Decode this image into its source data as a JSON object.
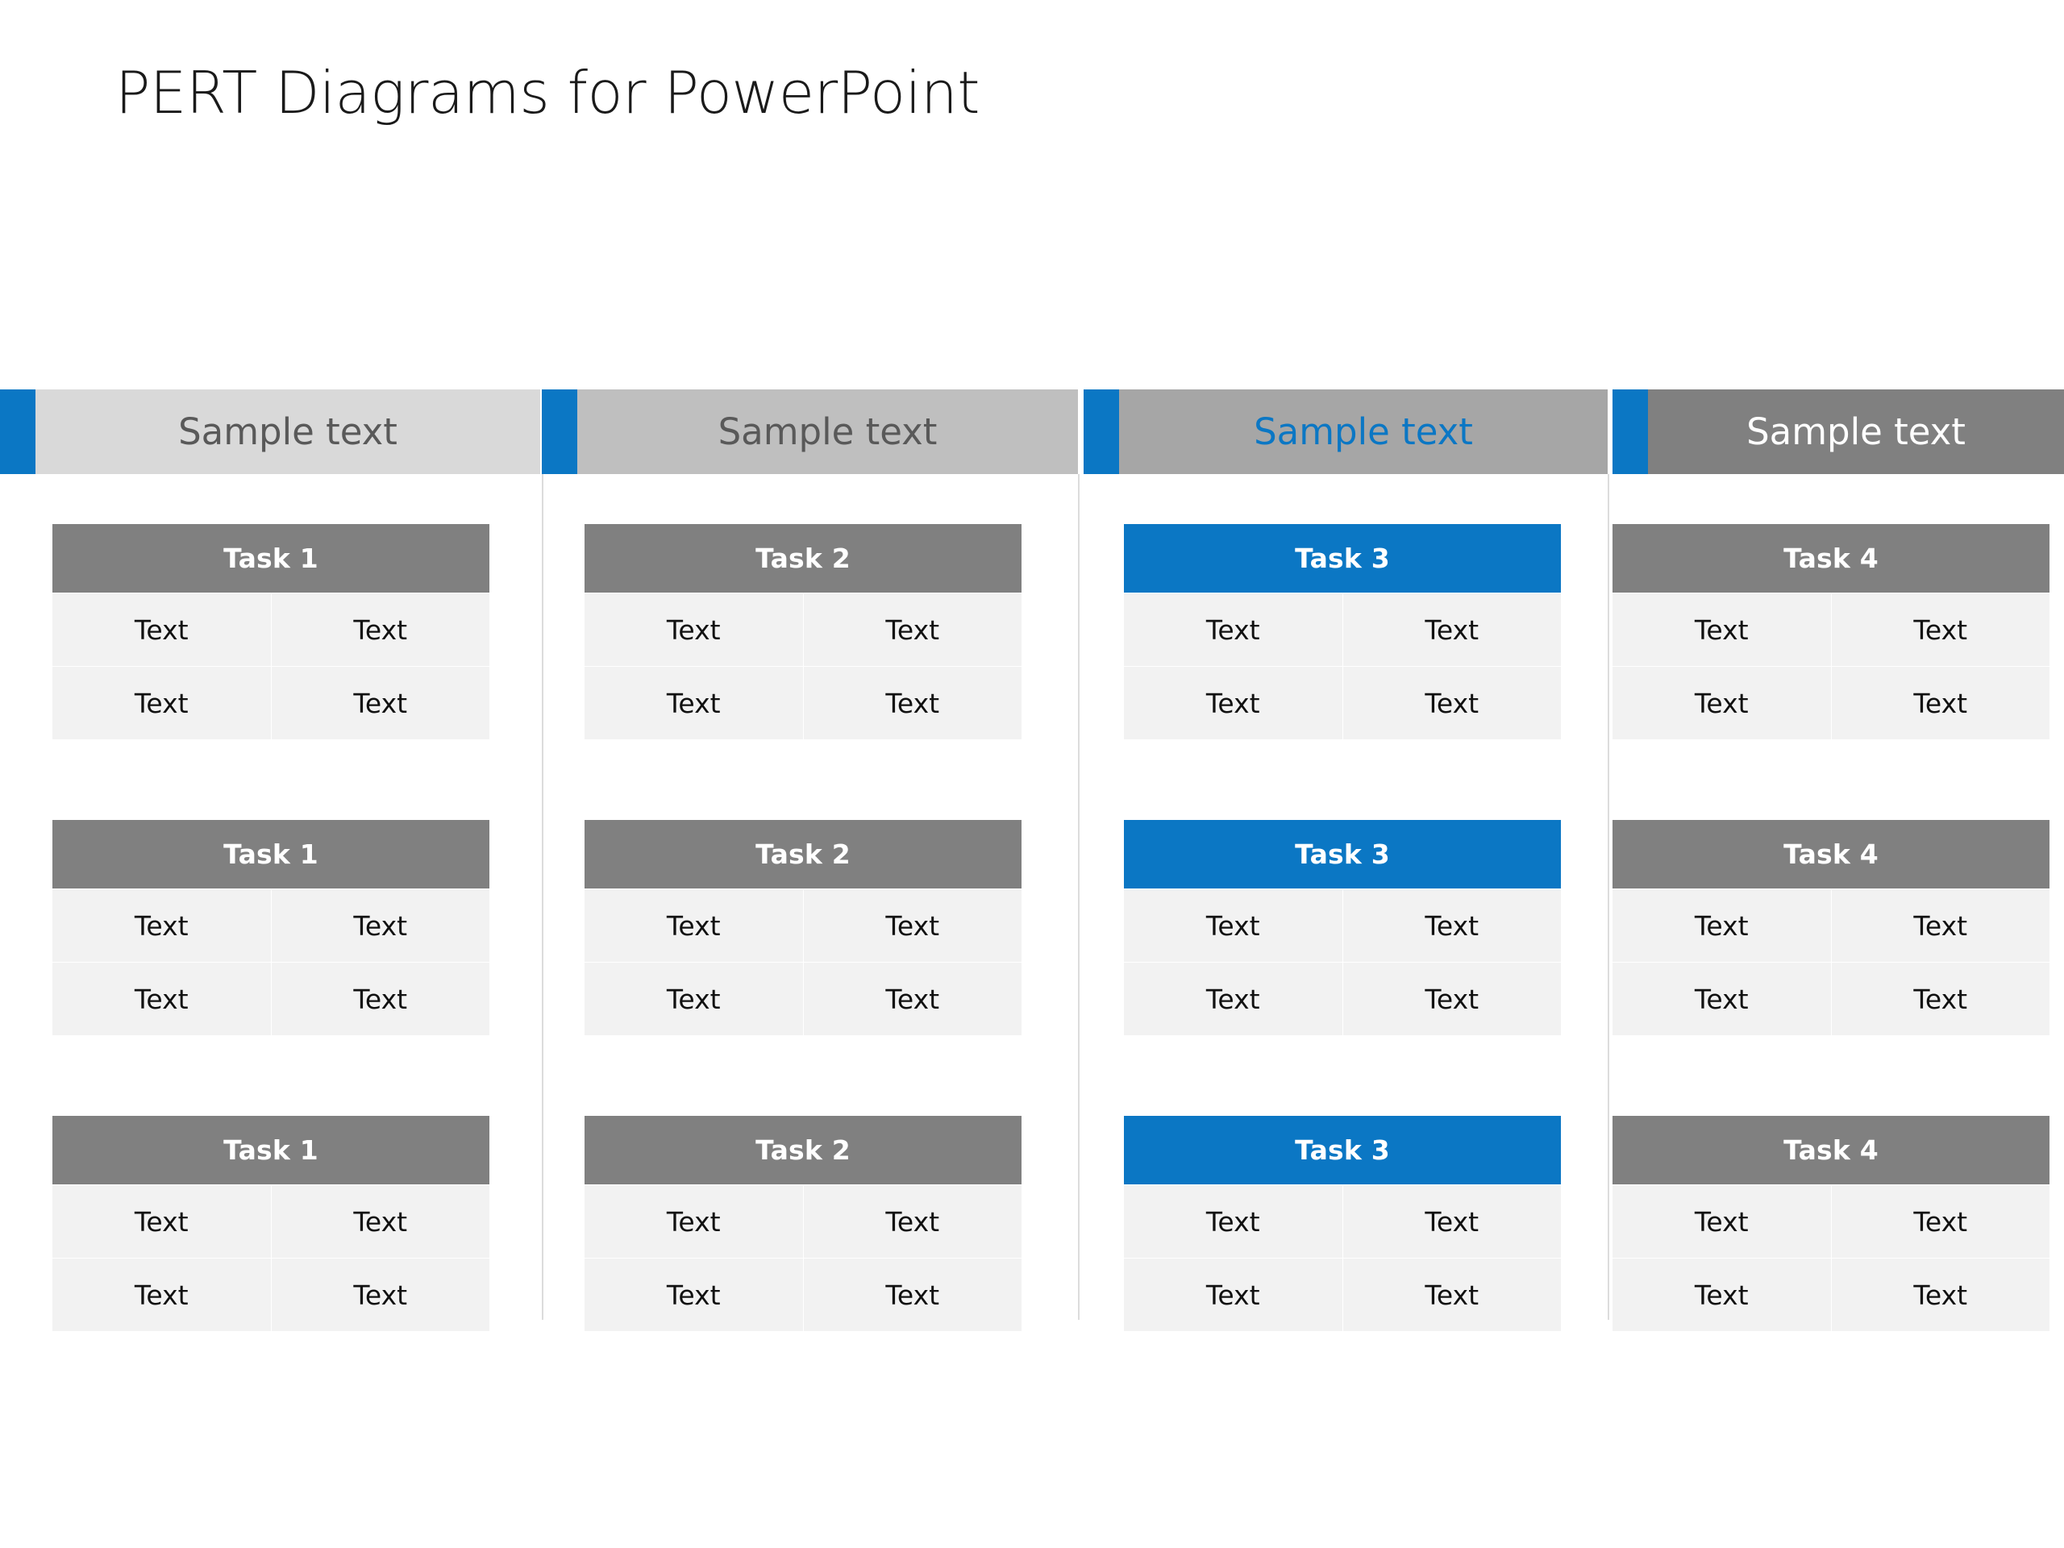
{
  "slide": {
    "title": "PERT Diagrams for PowerPoint",
    "background": "#FFFFFF"
  },
  "colors": {
    "accent_blue": "#0B77C4",
    "header_1_bg": "#D9D9D9",
    "header_2_bg": "#BFBFBF",
    "header_3_bg": "#A6A6A6",
    "header_4_bg": "#808080",
    "header_text_gray": "#595959",
    "header_text_white": "#FFFFFF",
    "task_header_gray": "#808080",
    "task_cell_bg": "#F2F2F2",
    "task_cell_text": "#111111",
    "separator": "#DCDCDC",
    "title_text": "#1A1A1A"
  },
  "columns": [
    {
      "header": {
        "label": "Sample text",
        "bg": "#D9D9D9",
        "text_color": "#595959",
        "tab_color": "#0B77C4"
      },
      "tasks": [
        {
          "title": "Task 1",
          "accent": "gray",
          "cells": [
            "Text",
            "Text",
            "Text",
            "Text"
          ]
        },
        {
          "title": "Task 1",
          "accent": "gray",
          "cells": [
            "Text",
            "Text",
            "Text",
            "Text"
          ]
        },
        {
          "title": "Task 1",
          "accent": "gray",
          "cells": [
            "Text",
            "Text",
            "Text",
            "Text"
          ]
        }
      ]
    },
    {
      "header": {
        "label": "Sample text",
        "bg": "#BFBFBF",
        "text_color": "#595959",
        "tab_color": "#0B77C4"
      },
      "tasks": [
        {
          "title": "Task 2",
          "accent": "gray",
          "cells": [
            "Text",
            "Text",
            "Text",
            "Text"
          ]
        },
        {
          "title": "Task 2",
          "accent": "gray",
          "cells": [
            "Text",
            "Text",
            "Text",
            "Text"
          ]
        },
        {
          "title": "Task 2",
          "accent": "gray",
          "cells": [
            "Text",
            "Text",
            "Text",
            "Text"
          ]
        }
      ]
    },
    {
      "header": {
        "label": "Sample text",
        "bg": "#A6A6A6",
        "text_color": "#0B77C4",
        "tab_color": "#0B77C4"
      },
      "tasks": [
        {
          "title": "Task 3",
          "accent": "blue",
          "cells": [
            "Text",
            "Text",
            "Text",
            "Text"
          ]
        },
        {
          "title": "Task 3",
          "accent": "blue",
          "cells": [
            "Text",
            "Text",
            "Text",
            "Text"
          ]
        },
        {
          "title": "Task 3",
          "accent": "blue",
          "cells": [
            "Text",
            "Text",
            "Text",
            "Text"
          ]
        }
      ]
    },
    {
      "header": {
        "label": "Sample text",
        "bg": "#808080",
        "text_color": "#FFFFFF",
        "tab_color": "#0B77C4"
      },
      "tasks": [
        {
          "title": "Task 4",
          "accent": "gray",
          "cells": [
            "Text",
            "Text",
            "Text",
            "Text"
          ]
        },
        {
          "title": "Task 4",
          "accent": "gray",
          "cells": [
            "Text",
            "Text",
            "Text",
            "Text"
          ]
        },
        {
          "title": "Task 4",
          "accent": "gray",
          "cells": [
            "Text",
            "Text",
            "Text",
            "Text"
          ]
        }
      ]
    }
  ]
}
